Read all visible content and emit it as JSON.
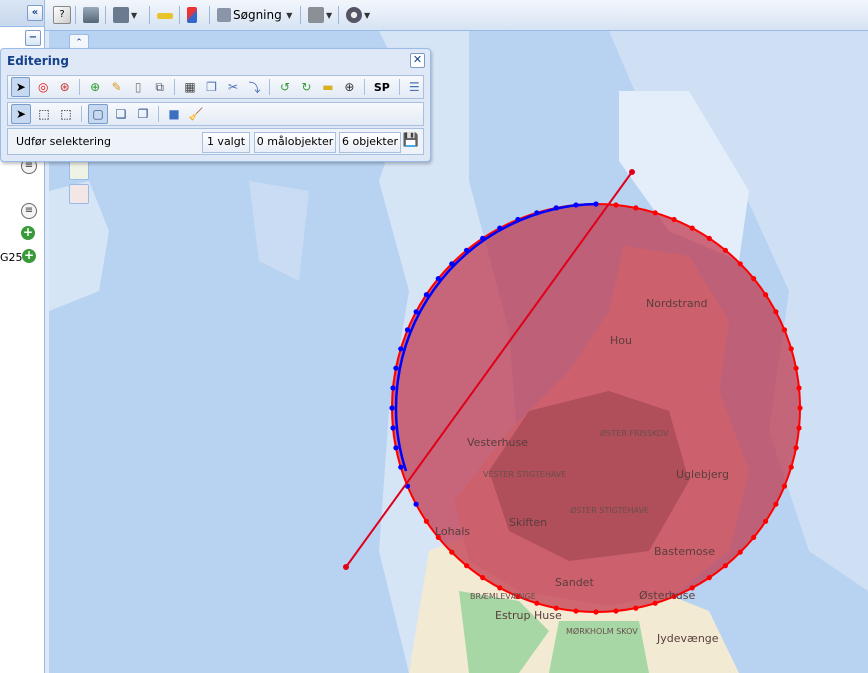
{
  "toolbar": {
    "search_label": "Søgning"
  },
  "left_panel": {
    "collapse_glyph": "«",
    "minimize_glyph": "−",
    "truncated_label": "G25"
  },
  "edit_panel": {
    "title": "Editering",
    "close_glyph": "✕",
    "sp_label": "SP",
    "status_label": "Udfør selektering",
    "selected_count": "1 valgt",
    "target_objects": "0 målobjekter",
    "objects_count": "6 objekter"
  },
  "map": {
    "place_labels": [
      "Nordstrand",
      "Hou",
      "Vesterhuse",
      "Uglebjerg",
      "Skiften",
      "Bastemose",
      "Sandet",
      "Østerhuse",
      "Lohals",
      "Estrup Huse",
      "Jydevænge"
    ],
    "area_labels": [
      "ØSTER FRISSKOV",
      "VESTER STIGTEHAVE",
      "ØSTER STIGTEHAVE",
      "BRÆMLEVÆNGE",
      "MØRKHOLM SKOV"
    ],
    "colors": {
      "water": "#b8d3f1",
      "shallow_water": "#d8e6f7",
      "selection_fill": "#c0354a",
      "selection_edge": "#ff0000",
      "selected_arc": "#0000ff"
    }
  }
}
